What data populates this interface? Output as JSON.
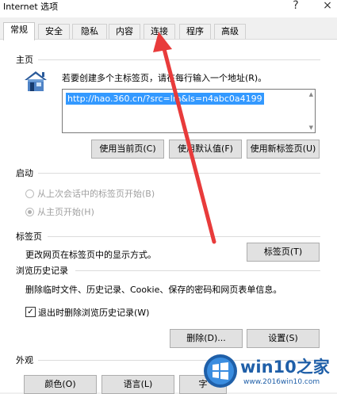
{
  "window": {
    "title": "Internet 选项",
    "help_glyph": "?",
    "close_glyph": "×"
  },
  "tabs": [
    "常规",
    "安全",
    "隐私",
    "内容",
    "连接",
    "程序",
    "高级"
  ],
  "homepage": {
    "group_label": "主页",
    "description": "若要创建多个主标签页，请在每行输入一个地址(R)。",
    "url": "http://hao.360.cn/?src=lm&ls=n4abc0a4199",
    "buttons": {
      "use_current": "使用当前页(C)",
      "use_default": "使用默认值(F)",
      "use_new_tab": "使用新标签页(U)"
    }
  },
  "startup": {
    "group_label": "启动",
    "option_last_session": "从上次会话中的标签页开始(B)",
    "option_homepage": "从主页开始(H)"
  },
  "tabs_group": {
    "group_label": "标签页",
    "description": "更改网页在标签页中的显示方式。",
    "button": "标签页(T)"
  },
  "history": {
    "group_label": "浏览历史记录",
    "description": "删除临时文件、历史记录、Cookie、保存的密码和网页表单信息。",
    "checkbox_label": "退出时删除浏览历史记录(W)",
    "checkbox_checked": true,
    "delete_button": "删除(D)...",
    "settings_button": "设置(S)"
  },
  "appearance": {
    "group_label": "外观",
    "colors_button": "颜色(O)",
    "languages_button": "语言(L)",
    "fonts_button": "字"
  },
  "watermark": {
    "brand": "win10之家",
    "url": "www.2016win10.com"
  },
  "colors": {
    "selection": "#3399ff",
    "arrow": "#e83b3b",
    "brand_blue": "#1f5fa8"
  }
}
